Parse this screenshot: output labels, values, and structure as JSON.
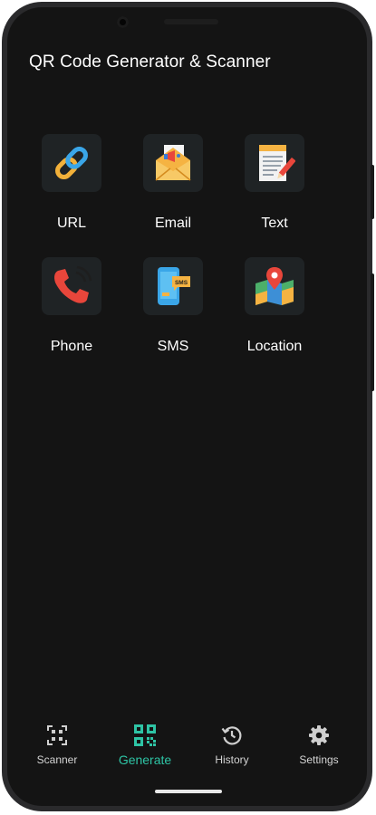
{
  "app": {
    "title": "QR Code Generator & Scanner"
  },
  "generate": {
    "items": [
      {
        "label": "URL",
        "icon": "link-icon"
      },
      {
        "label": "Email",
        "icon": "email-envelope-icon"
      },
      {
        "label": "Text",
        "icon": "notepad-pencil-icon"
      },
      {
        "label": "Phone",
        "icon": "phone-ringing-icon"
      },
      {
        "label": "SMS",
        "icon": "sms-phone-icon"
      },
      {
        "label": "Location",
        "icon": "map-pin-icon"
      }
    ]
  },
  "nav": {
    "items": [
      {
        "label": "Scanner",
        "icon": "qr-scan-icon"
      },
      {
        "label": "Generate",
        "icon": "qr-code-icon",
        "active": true
      },
      {
        "label": "History",
        "icon": "history-icon"
      },
      {
        "label": "Settings",
        "icon": "gear-icon"
      }
    ]
  },
  "colors": {
    "background": "#141414",
    "tile": "#1f2325",
    "accent": "#2ec4a5"
  }
}
